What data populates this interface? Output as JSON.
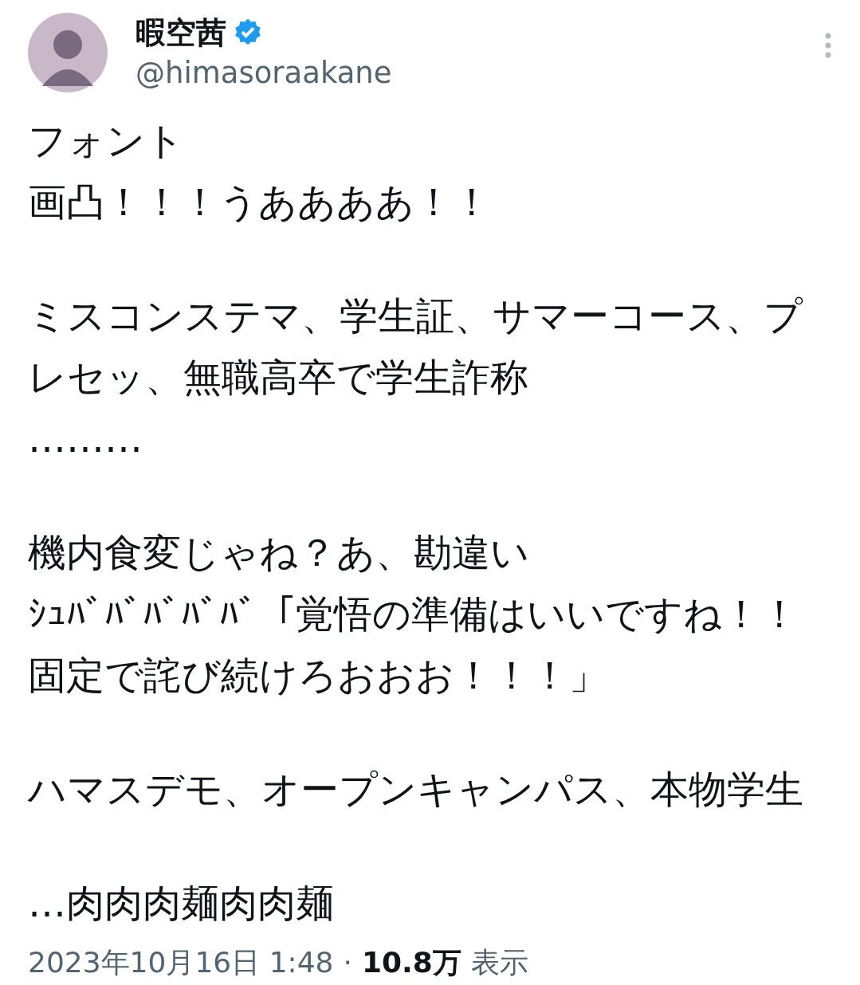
{
  "author": {
    "name": "暇空茜",
    "verified": true,
    "handle": "@himasoraakane"
  },
  "paragraphs": [
    {
      "lines": [
        "フォント",
        "画凸！！！うああああ！！"
      ]
    },
    {
      "lines": [
        "ミスコンステマ、学生証、サマーコース、プ",
        "レセッ、無職高卒で学生詐称",
        "………"
      ]
    },
    {
      "lines": [
        "機内食変じゃね？あ、勘違い",
        "ｼｭﾊﾞﾊﾞﾊﾞﾊﾞﾊﾞ「覚悟の準備はいいですね！！",
        "固定で詫び続けろおおお！！！」"
      ]
    },
    {
      "lines": [
        "ハマスデモ、オープンキャンパス、本物学生"
      ]
    },
    {
      "lines": [
        "…肉肉肉麺肉肉麺"
      ]
    }
  ],
  "meta": {
    "time": "2023年10月16日 1:48",
    "separator": "·",
    "views": "10.8万",
    "views_label": "表示"
  }
}
